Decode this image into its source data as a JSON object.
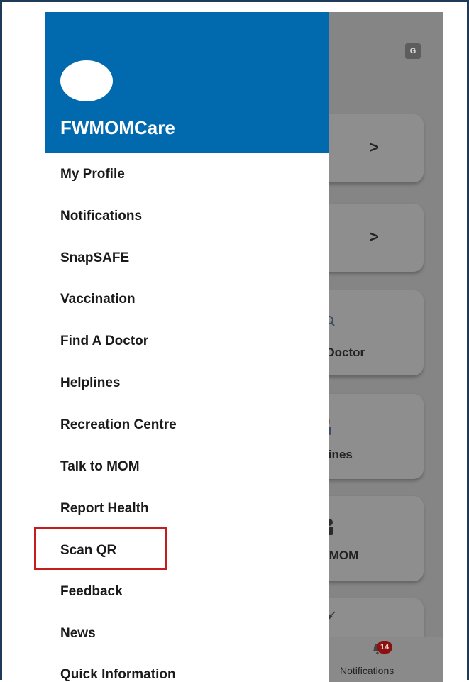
{
  "drawer": {
    "app_name": "FWMOMCare",
    "items": [
      {
        "label": "My Profile"
      },
      {
        "label": "Notifications"
      },
      {
        "label": "SnapSAFE"
      },
      {
        "label": "Vaccination"
      },
      {
        "label": "Find A Doctor"
      },
      {
        "label": "Helplines"
      },
      {
        "label": "Recreation Centre"
      },
      {
        "label": "Talk to MOM"
      },
      {
        "label": "Report Health"
      },
      {
        "label": "Scan QR"
      },
      {
        "label": "Feedback"
      },
      {
        "label": "News"
      },
      {
        "label": "Quick Information"
      }
    ],
    "highlighted_item": "Scan QR"
  },
  "background": {
    "cards": [
      {
        "icon": "chevron-right-icon",
        "chevron": ">"
      },
      {
        "icon": "chevron-right-icon",
        "chevron": ">"
      },
      {
        "icon": "doctor-search-icon",
        "label": "A Doctor"
      },
      {
        "icon": "helpline-person-icon",
        "label": "lplines"
      },
      {
        "icon": "talk-people-icon",
        "label": "to MOM"
      },
      {
        "icon": "syringe-icon"
      }
    ],
    "bottom_nav": {
      "notifications_label": "Notifications",
      "badge_count": "14"
    }
  },
  "colors": {
    "header_blue": "#0169ad",
    "highlight_red": "#c41d1d",
    "frame_border": "#1f3a56"
  }
}
